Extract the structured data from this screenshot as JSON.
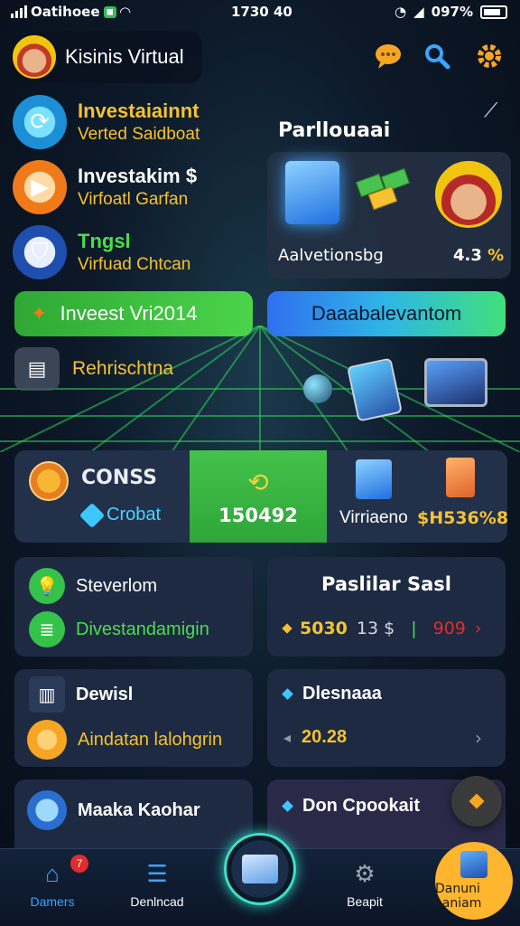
{
  "status_bar": {
    "carrier": "Oatihoee",
    "time": "1730 40",
    "battery": "097%"
  },
  "header": {
    "profile_name": "Kisinis Virtual",
    "icons": [
      "chat-icon",
      "search-icon",
      "gear-icon"
    ]
  },
  "menu": [
    {
      "title": "Investaiainnt",
      "subtitle": "Verted Saidboat",
      "icon": "cycle-icon",
      "title_color": "#f6c232"
    },
    {
      "title": "Investakim $",
      "subtitle": "Virfoatl Garfan",
      "icon": "play-icon",
      "title_color": "#ffffff"
    },
    {
      "title": "Tngsl",
      "subtitle": "Virfuad Chtcan",
      "icon": "shield-icon",
      "title_color": "#4ddc4d"
    }
  ],
  "panel": {
    "title": "Parllouaai",
    "promo_label": "Aalvetionsbg",
    "promo_value": "4.3",
    "promo_pct": "%"
  },
  "actions": {
    "invest_label": "Inveest Vri2014",
    "dashboard_label": "Daaabalevantom"
  },
  "refresh": {
    "label": "Rehrischtna"
  },
  "coins": {
    "label": "CONSS",
    "gem_label": "Crobat",
    "green_value": "150492",
    "vr_label": "Virriaeno",
    "vr_value": "$H536%8"
  },
  "cards": {
    "left1": {
      "row1": "Steverlom",
      "row2": "Divestandamigin"
    },
    "right1": {
      "title": "Paslilar Sasl",
      "v1": "5030",
      "v2": "13 $",
      "v3": "909"
    },
    "left2": {
      "row1": "Dewisl",
      "row2": "Aindatan lalohgrin"
    },
    "right2": {
      "title": "Dlesnaaa",
      "value": "20.28"
    },
    "left3": {
      "row1": "Maaka Kaohar"
    },
    "right3": {
      "title": "Don Cpookait"
    }
  },
  "bottom_nav": [
    {
      "label": "Damers",
      "icon": "home-icon",
      "badge": "7"
    },
    {
      "label": "Denlncad",
      "icon": "document-icon"
    },
    {
      "label": "",
      "icon": "screen-icon"
    },
    {
      "label": "Beapit",
      "icon": "gear-icon"
    },
    {
      "label": "Danuni Laniam",
      "icon": "cube-icon"
    }
  ],
  "colors": {
    "accent_green": "#4bd44a",
    "accent_yellow": "#f6c232",
    "accent_blue": "#2fb6e6",
    "card_bg": "#1d2a42"
  }
}
